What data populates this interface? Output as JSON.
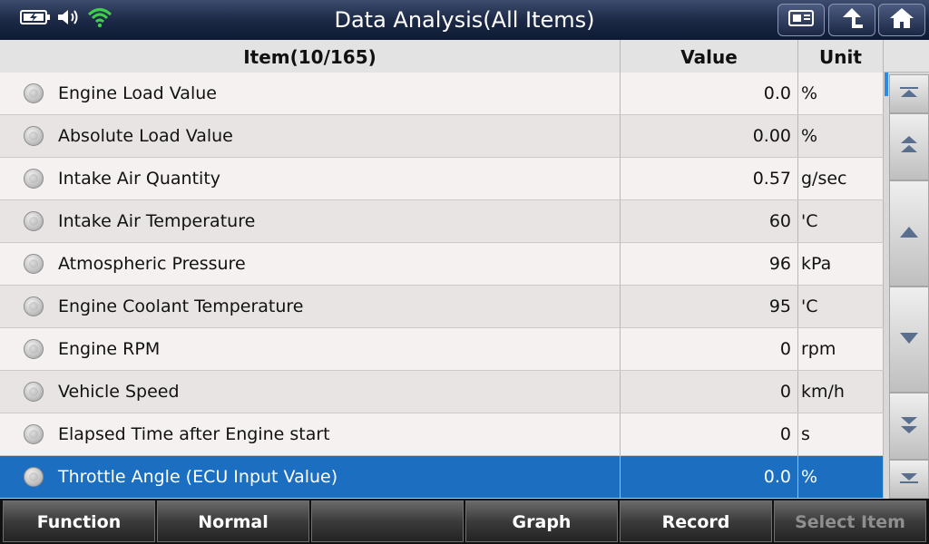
{
  "header": {
    "title": "Data Analysis(All Items)",
    "icons": [
      "battery-icon",
      "speaker-icon",
      "wifi-icon"
    ],
    "buttons": [
      "screenshot-icon",
      "back-icon",
      "home-icon"
    ]
  },
  "table": {
    "columns": {
      "item": "Item(10/165)",
      "value": "Value",
      "unit": "Unit"
    },
    "rows": [
      {
        "label": "Engine Load Value",
        "value": "0.0",
        "unit": "%"
      },
      {
        "label": "Absolute Load Value",
        "value": "0.00",
        "unit": "%"
      },
      {
        "label": "Intake Air Quantity",
        "value": "0.57",
        "unit": "g/sec"
      },
      {
        "label": "Intake Air Temperature",
        "value": "60",
        "unit": "'C"
      },
      {
        "label": "Atmospheric Pressure",
        "value": "96",
        "unit": "kPa"
      },
      {
        "label": "Engine Coolant Temperature",
        "value": "95",
        "unit": "'C"
      },
      {
        "label": "Engine RPM",
        "value": "0",
        "unit": "rpm"
      },
      {
        "label": "Vehicle Speed",
        "value": "0",
        "unit": "km/h"
      },
      {
        "label": "Elapsed Time after Engine start",
        "value": "0",
        "unit": "s"
      },
      {
        "label": "Throttle Angle (ECU Input Value)",
        "value": "0.0",
        "unit": "%"
      }
    ],
    "selected_index": 9
  },
  "scrollbar": {
    "buttons": [
      "scroll-top-icon",
      "page-up-icon",
      "line-up-icon",
      "line-down-icon",
      "page-down-icon",
      "scroll-bottom-icon"
    ]
  },
  "toolbar": {
    "function": "Function",
    "normal": "Normal",
    "empty": "",
    "graph": "Graph",
    "record": "Record",
    "select_item": "Select Item"
  },
  "colors": {
    "title_bg": "#1c2a47",
    "selected_row": "#1c6fc0",
    "wifi": "#3fd04a",
    "disabled_text": "#8f8f8f"
  }
}
